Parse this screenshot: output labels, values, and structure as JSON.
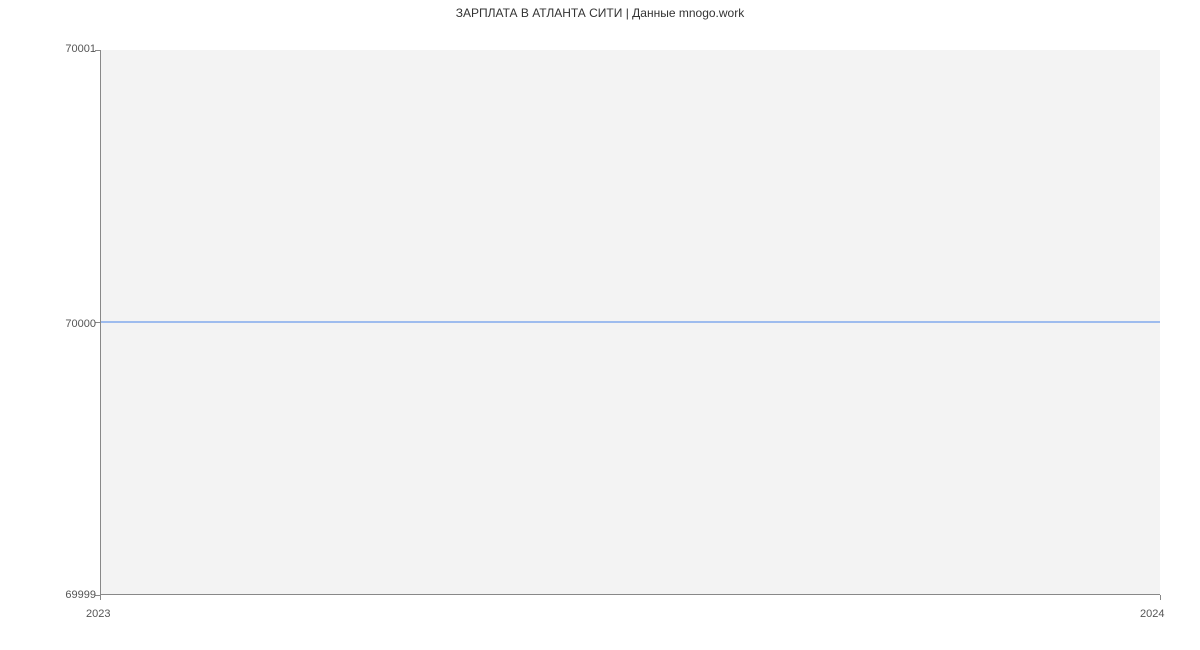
{
  "chart_data": {
    "type": "line",
    "title": "ЗАРПЛАТА В АТЛАНТА СИТИ | Данные mnogo.work",
    "x": [
      2023,
      2024
    ],
    "values": [
      70000,
      70000
    ],
    "x_ticks": [
      "2023",
      "2024"
    ],
    "y_ticks": [
      "69999",
      "70000",
      "70001"
    ],
    "xlabel": "",
    "ylabel": "",
    "ylim": [
      69999,
      70001
    ],
    "line_color": "#4a86e8"
  }
}
